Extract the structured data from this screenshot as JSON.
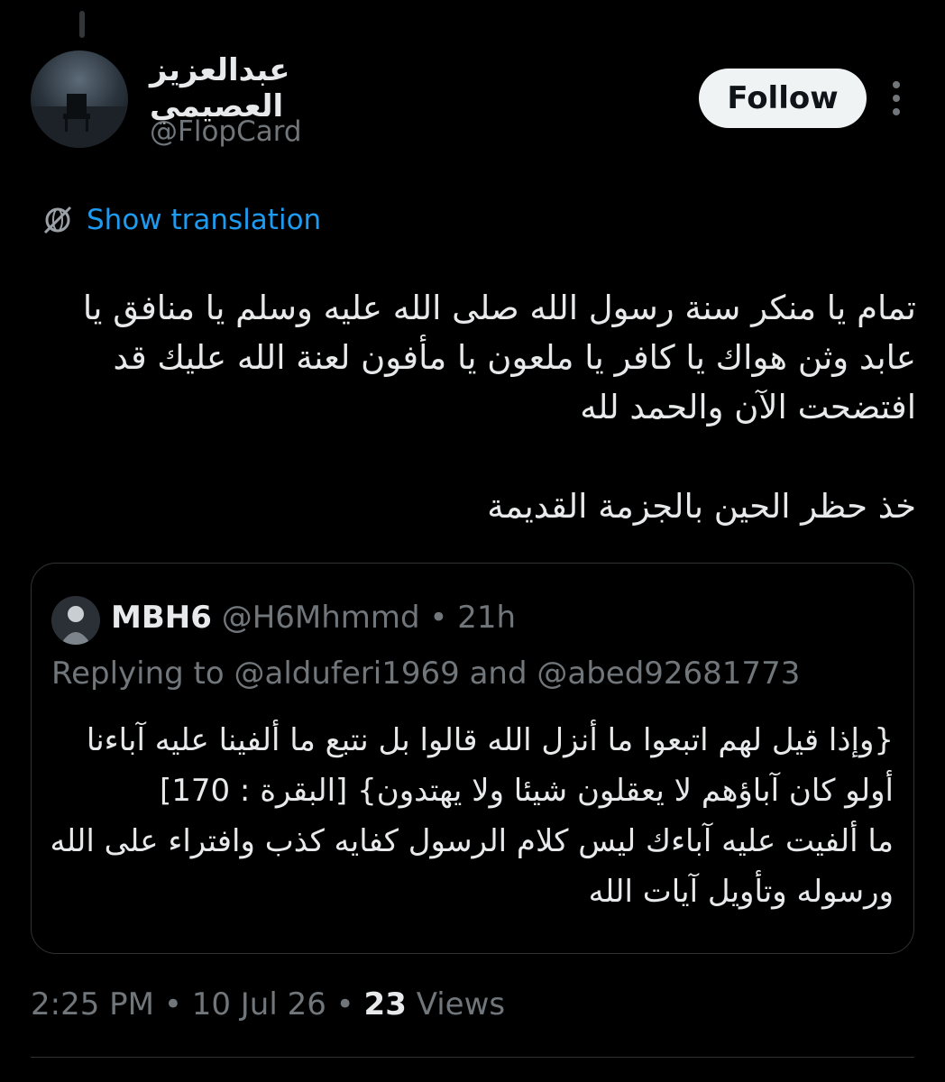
{
  "author": {
    "display_name": "عبدالعزيز العصيمي",
    "handle": "@FlopCard",
    "avatar_icon": "profile-photo"
  },
  "actions": {
    "follow_label": "Follow",
    "more_icon": "more-vertical-icon"
  },
  "translation": {
    "label": "Show translation",
    "icon": "translate-globe-icon",
    "accent": "#1d9bf0"
  },
  "tweet": {
    "lines": [
      "تمام يا منكر سنة رسول الله صلى الله عليه وسلم يا منافق يا",
      "عابد وثن هواك يا كافر يا ملعون يا مأفون لعنة الله عليك قد",
      "افتضحت الآن والحمد لله",
      "خذ حظر الحين بالجزمة القديمة"
    ]
  },
  "quote": {
    "name": "MBH6",
    "handle": "@H6Mhmmd",
    "separator": "•",
    "time": "21h",
    "replying_prefix": "Replying to",
    "mention_1": "@alduferi1969",
    "conjunction": "and",
    "mention_2": "@abed92681773",
    "lines": [
      "{وإذا قيل لهم اتبعوا ما أنزل الله قالوا بل نتبع ما ألفينا عليه آباءنا",
      "أولو كان آباؤهم لا يعقلون شيئا ولا يهتدون} [البقرة : 170]",
      "ما ألفيت عليه آباءك ليس كلام الرسول كفايه كذب وافتراء على الله",
      "ورسوله وتأويل آيات الله"
    ]
  },
  "meta": {
    "time": "2:25 PM",
    "separator": "•",
    "date": "10 Jul 26",
    "views_count": "23",
    "views_label": "Views"
  },
  "colors": {
    "background": "#000000",
    "text": "#e7e9ea",
    "muted": "#71767b",
    "border": "#2f3336",
    "button_bg": "#eff3f4"
  }
}
